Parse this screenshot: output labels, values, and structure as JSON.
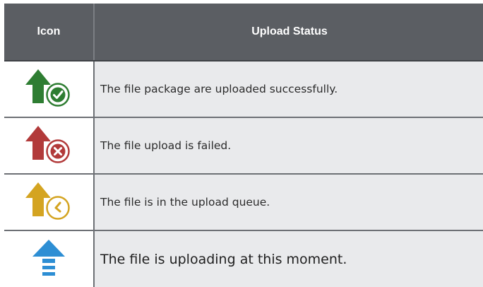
{
  "table": {
    "headers": {
      "icon": "Icon",
      "status": "Upload Status"
    },
    "rows": [
      {
        "icon": "upload-success-icon",
        "status": "The file package are uploaded successfully.",
        "color": "#2e7d32"
      },
      {
        "icon": "upload-failed-icon",
        "status": "The file upload is failed.",
        "color": "#b23a3a"
      },
      {
        "icon": "upload-queued-icon",
        "status": "The file is in the upload queue.",
        "color": "#d4a421"
      },
      {
        "icon": "uploading-icon",
        "status": "The file is uploading at this moment.",
        "color": "#2d8ed4"
      }
    ]
  }
}
